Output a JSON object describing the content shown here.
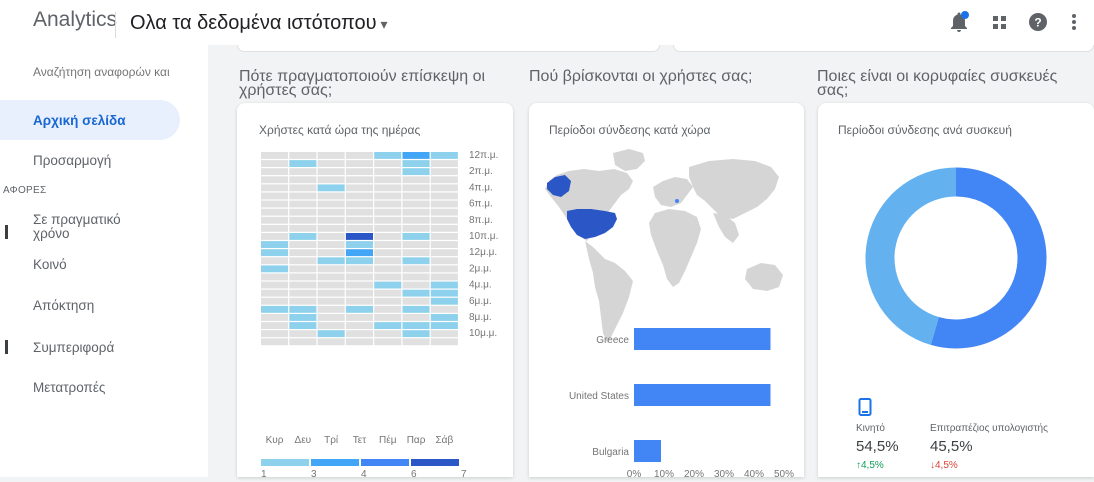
{
  "header": {
    "app_name": "Analytics",
    "property": "Ολα τα δεδομένα ιστότοπου",
    "icons": [
      "notifications-icon",
      "apps-grid-icon",
      "help-icon",
      "more-vert-icon"
    ],
    "accent": "#1a73e8"
  },
  "sidebar": {
    "search_placeholder": "Αναζήτηση αναφορών και",
    "items": [
      {
        "label": "Αρχική σελίδα",
        "active": true
      },
      {
        "label": "Προσαρμογή"
      }
    ],
    "section_label": "ΑΦΟΡΕΣ",
    "report_items": [
      {
        "label": "Σε πραγματικό\nχρόνο"
      },
      {
        "label": "Κοινό"
      },
      {
        "label": "Απόκτηση"
      },
      {
        "label": "Συμπεριφορά"
      },
      {
        "label": "Μετατροπές"
      }
    ]
  },
  "sections": {
    "when": "Πότε πραγματοποιούν επίσκεψη οι\nχρήστες σας;",
    "where": "Πού βρίσκονται οι χρήστες σας;",
    "devices": "Ποιες είναι οι κορυφαίες συσκευές\nσας;"
  },
  "cards": {
    "heatmap_title": "Χρήστες κατά ώρα της ημέρας",
    "geo_title": "Περίοδοι σύνδεσης κατά χώρα",
    "device_title": "Περίοδοι σύνδεσης ανά συσκευή"
  },
  "chart_data": [
    {
      "type": "heatmap",
      "title": "Χρήστες κατά ώρα της ημέρας",
      "columns": [
        "Κυρ",
        "Δευ",
        "Τρί",
        "Τετ",
        "Πέμ",
        "Παρ",
        "Σάβ"
      ],
      "row_tick_labels": [
        "12π.μ.",
        "2π.μ.",
        "4π.μ.",
        "6π.μ.",
        "8π.μ.",
        "10π.μ.",
        "12μ.μ.",
        "2μ.μ.",
        "4μ.μ.",
        "6μ.μ.",
        "8μ.μ.",
        "10μ.μ."
      ],
      "levels": [
        [
          0,
          0,
          0,
          0,
          1,
          2,
          1
        ],
        [
          0,
          1,
          0,
          0,
          0,
          1,
          0
        ],
        [
          0,
          0,
          0,
          0,
          0,
          1,
          0
        ],
        [
          0,
          0,
          0,
          0,
          0,
          0,
          0
        ],
        [
          0,
          0,
          1,
          0,
          0,
          0,
          0
        ],
        [
          0,
          0,
          0,
          0,
          0,
          0,
          0
        ],
        [
          0,
          0,
          0,
          0,
          0,
          0,
          0
        ],
        [
          0,
          0,
          0,
          0,
          0,
          0,
          0
        ],
        [
          0,
          0,
          0,
          0,
          0,
          0,
          0
        ],
        [
          0,
          0,
          0,
          0,
          0,
          0,
          0
        ],
        [
          0,
          1,
          0,
          4,
          0,
          1,
          0
        ],
        [
          1,
          0,
          0,
          1,
          0,
          0,
          0
        ],
        [
          1,
          0,
          0,
          2,
          0,
          0,
          0
        ],
        [
          0,
          0,
          1,
          1,
          0,
          1,
          0
        ],
        [
          1,
          0,
          0,
          0,
          0,
          0,
          0
        ],
        [
          0,
          0,
          0,
          0,
          0,
          0,
          0
        ],
        [
          0,
          0,
          0,
          0,
          1,
          0,
          1
        ],
        [
          0,
          0,
          0,
          0,
          0,
          1,
          1
        ],
        [
          0,
          0,
          0,
          0,
          0,
          0,
          1
        ],
        [
          1,
          1,
          0,
          1,
          0,
          1,
          0
        ],
        [
          0,
          1,
          0,
          0,
          0,
          0,
          1
        ],
        [
          0,
          1,
          0,
          0,
          1,
          1,
          1
        ],
        [
          0,
          0,
          1,
          0,
          0,
          1,
          0
        ],
        [
          0,
          0,
          0,
          0,
          0,
          0,
          0
        ]
      ],
      "legend_labels": [
        "1",
        "3",
        "4",
        "6",
        "7"
      ],
      "colors": [
        "#e0e0e0",
        "#8ed1ec",
        "#42a5f5",
        "#4285f4",
        "#2a56c6"
      ]
    },
    {
      "type": "bar",
      "orientation": "horizontal",
      "title": "Περίοδοι σύνδεσης κατά χώρα",
      "categories": [
        "Greece",
        "United States",
        "Bulgaria"
      ],
      "values": [
        45.5,
        45.5,
        9
      ],
      "xlim": [
        0,
        50
      ],
      "x_ticks": [
        "0%",
        "10%",
        "20%",
        "30%",
        "40%",
        "50%"
      ],
      "bar_color": "#4285f4"
    },
    {
      "type": "pie",
      "donut": true,
      "title": "Περίοδοι σύνδεσης ανά συσκευή",
      "slices": [
        {
          "name": "Κινητό",
          "value": 54.5,
          "change": "4,5%",
          "trend": "up",
          "color": "#4285f4"
        },
        {
          "name": "Επιτραπέζιος υπολογιστής",
          "value": 45.5,
          "change": "4,5%",
          "trend": "down",
          "color": "#63b2ef"
        }
      ],
      "labels_pct": [
        "54,5%",
        "45,5%"
      ]
    }
  ],
  "colors": {
    "up": "#0f9d58",
    "down": "#db4437",
    "map_land": "#d5d5d5",
    "map_highlight": "#2a56c6",
    "map_secondary": "#4285f4"
  }
}
